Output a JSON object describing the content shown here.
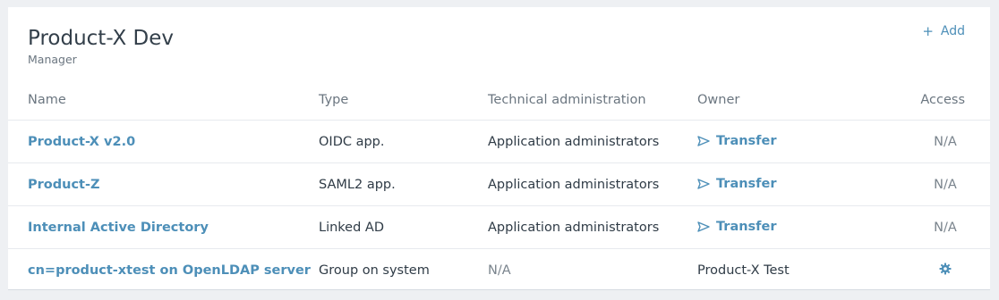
{
  "header": {
    "title": "Product-X Dev",
    "subtitle": "Manager",
    "add_label": "Add"
  },
  "columns": {
    "name": "Name",
    "type": "Type",
    "tech_admin": "Technical administration",
    "owner": "Owner",
    "access": "Access"
  },
  "rows": [
    {
      "name": "Product-X v2.0",
      "type": "OIDC app.",
      "tech_admin": "Application administrators",
      "owner": "Transfer",
      "access": "N/A"
    },
    {
      "name": "Product-Z",
      "type": "SAML2 app.",
      "tech_admin": "Application administrators",
      "owner": "Transfer",
      "access": "N/A"
    },
    {
      "name": "Internal Active Directory",
      "type": "Linked AD",
      "tech_admin": "Application administrators",
      "owner": "Transfer",
      "access": "N/A"
    },
    {
      "name": "cn=product-xtest on OpenLDAP server",
      "type": "Group on system",
      "tech_admin": "N/A",
      "owner": "Product-X Test",
      "access_icon": "gear-icon"
    }
  ],
  "colors": {
    "accent": "#4d8fb8",
    "muted": "#7a848d",
    "background": "#eef0f3"
  }
}
